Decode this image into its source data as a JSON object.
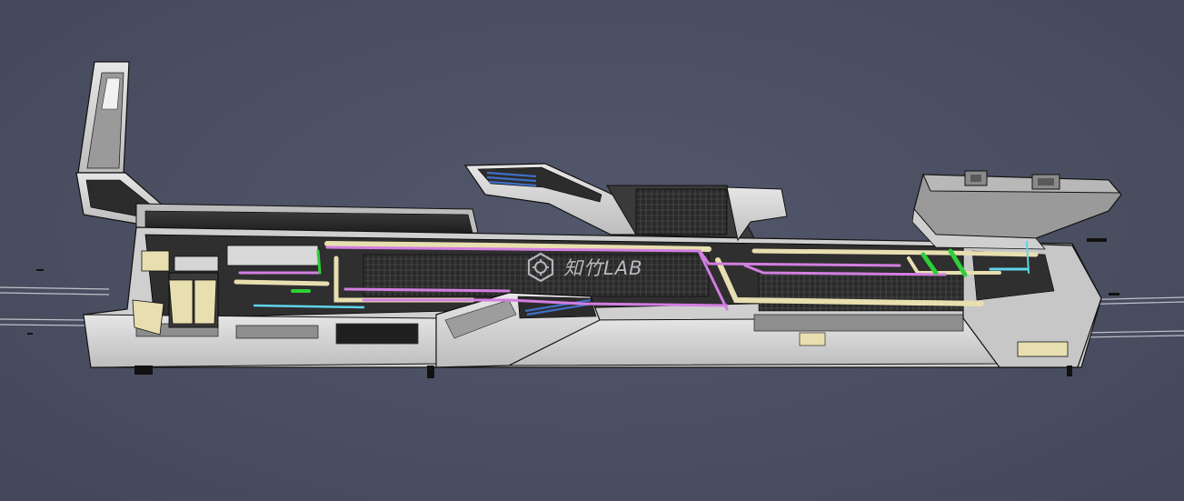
{
  "viewport": {
    "background_color": "#4a4e61"
  },
  "model": {
    "structure_color": "#d9d9d9",
    "edge_color": "#111111",
    "pipe_colors": {
      "magenta": "#d27fe0",
      "beige": "#e8dfb0",
      "green": "#2fcf3a",
      "cyan": "#5fd4e8",
      "blue": "#3f6fc4"
    }
  },
  "watermark": {
    "text": "知竹LAB",
    "logo_icon": "gear-hexagon-logo-icon"
  }
}
